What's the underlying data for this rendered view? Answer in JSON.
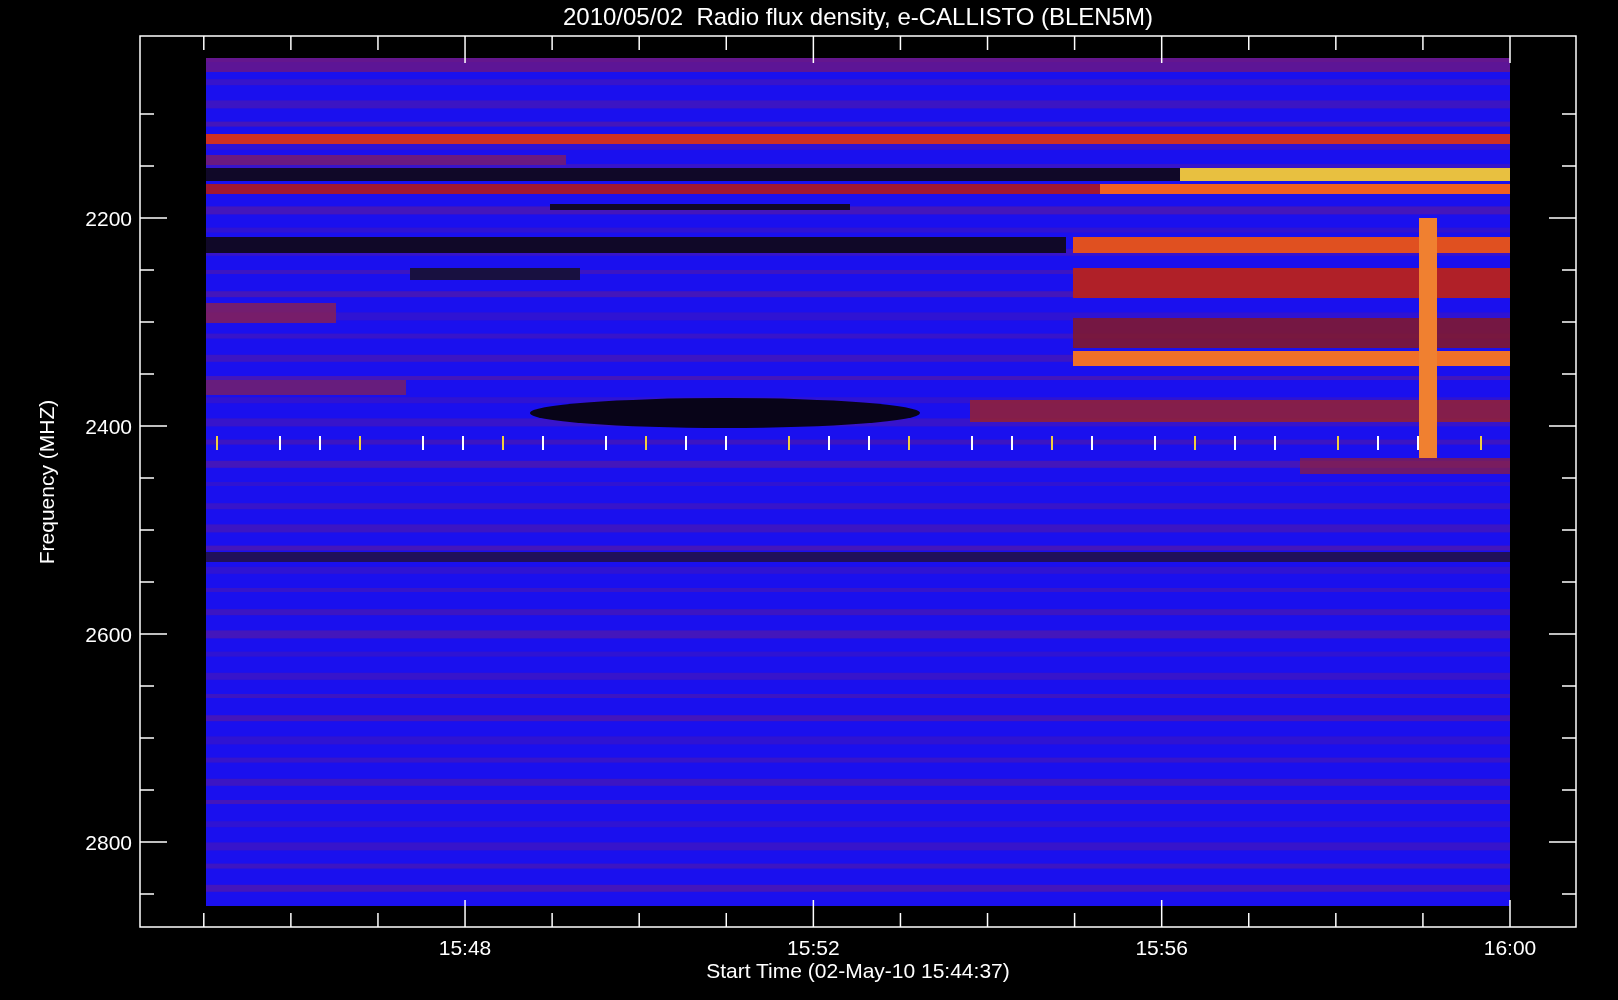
{
  "title": "2010/05/02  Radio flux density, e-CALLISTO (BLEN5M)",
  "ylabel": "Frequency (MHZ)",
  "xlabel": "Start Time (02-May-10 15:44:37)",
  "yticks": [
    "2200",
    "2400",
    "2600",
    "2800"
  ],
  "xticks": [
    "15:48",
    "15:52",
    "15:56",
    "16:00"
  ]
}
